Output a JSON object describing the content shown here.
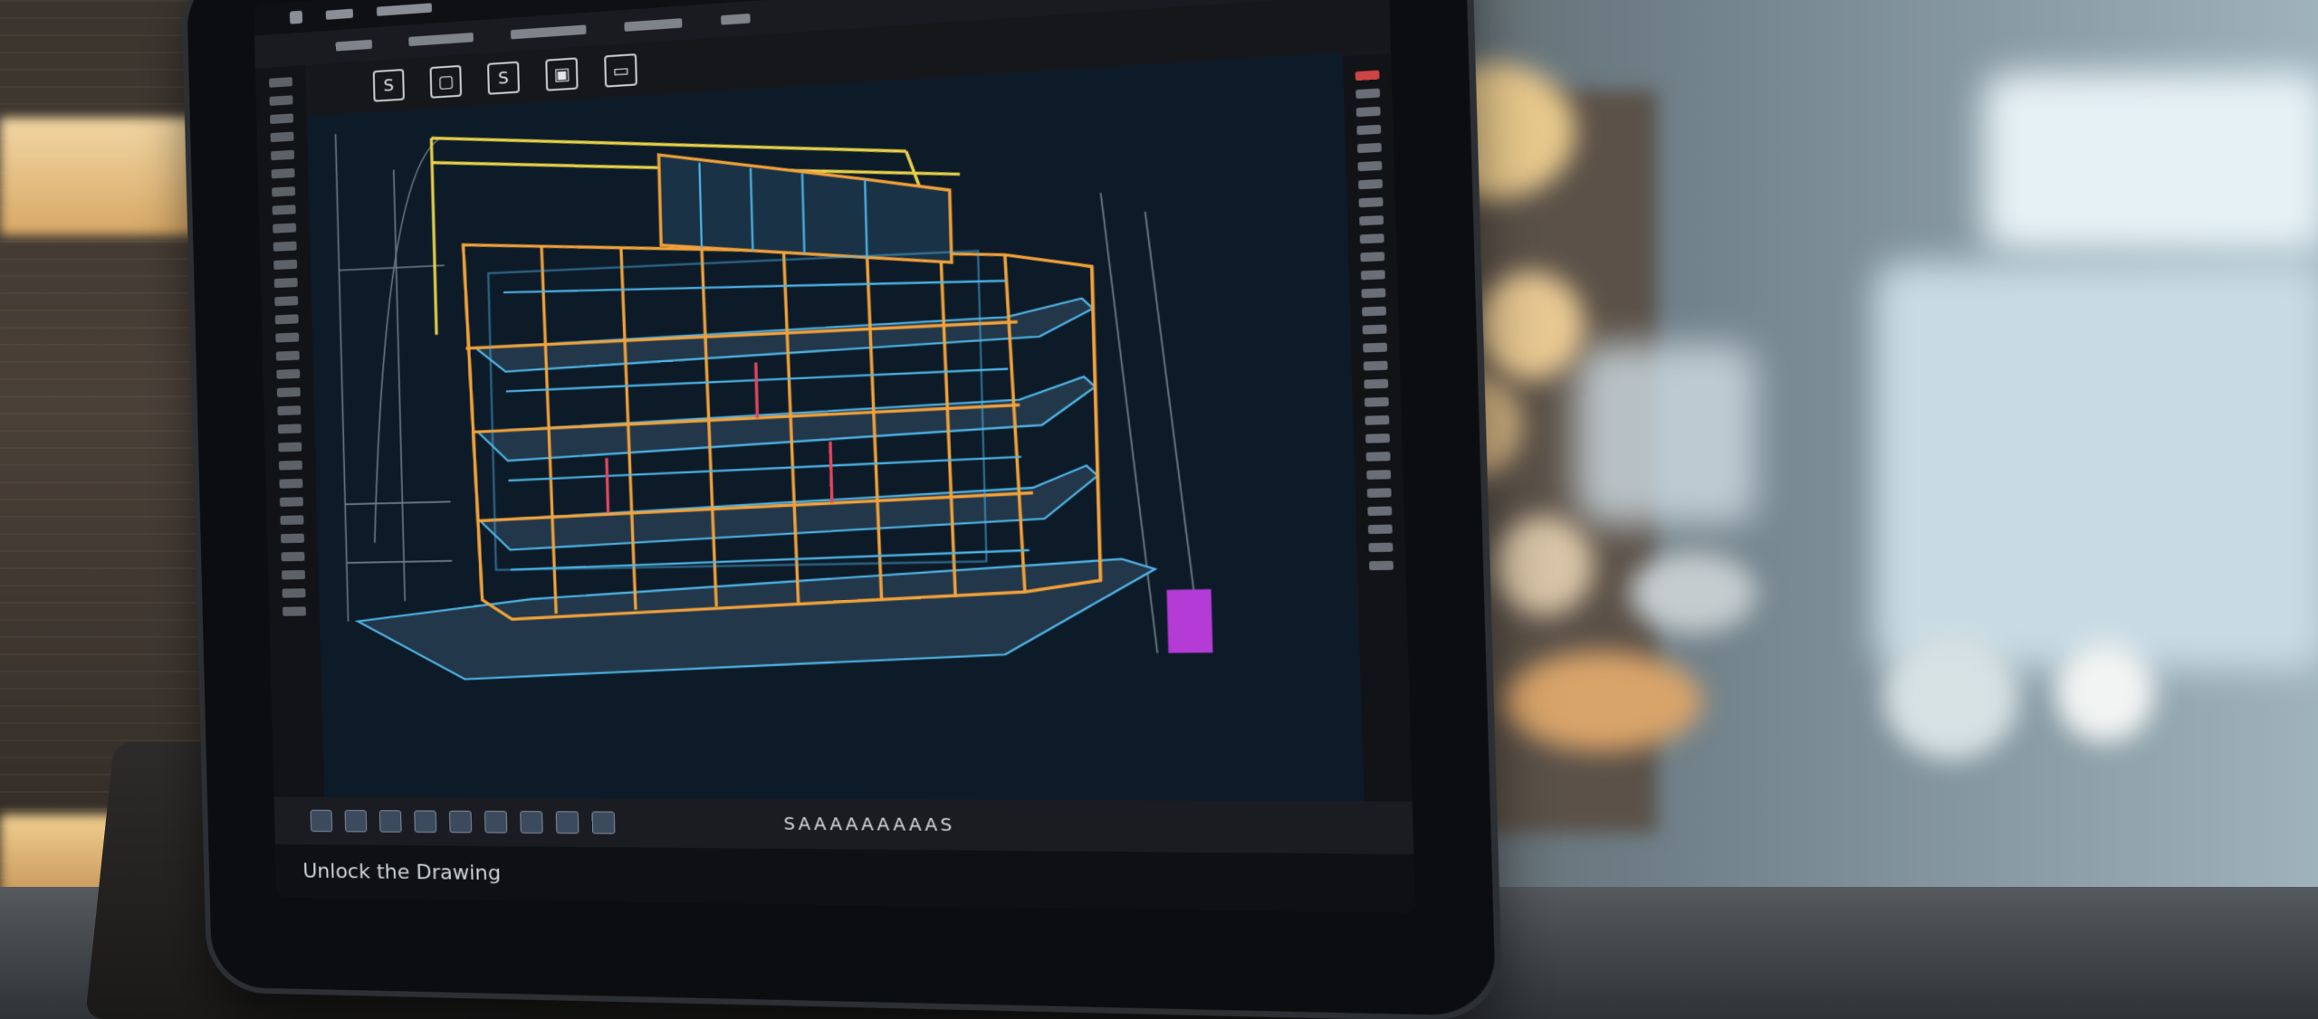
{
  "app": {
    "menu_items": [
      "",
      "",
      "",
      "",
      ""
    ],
    "ribbon_glyphs": [
      "S",
      "▢",
      "S",
      "▣",
      "▭"
    ],
    "status_text": "SAAAAAAAAAS",
    "bottom_text": "Unlock the Drawing"
  },
  "colors": {
    "wire_orange": "#f2a23a",
    "wire_blue": "#4fb6e8",
    "wire_yellow": "#e7d24a",
    "viewport_bg": "#0d1b29",
    "accent_purple": "#b43bd6"
  }
}
